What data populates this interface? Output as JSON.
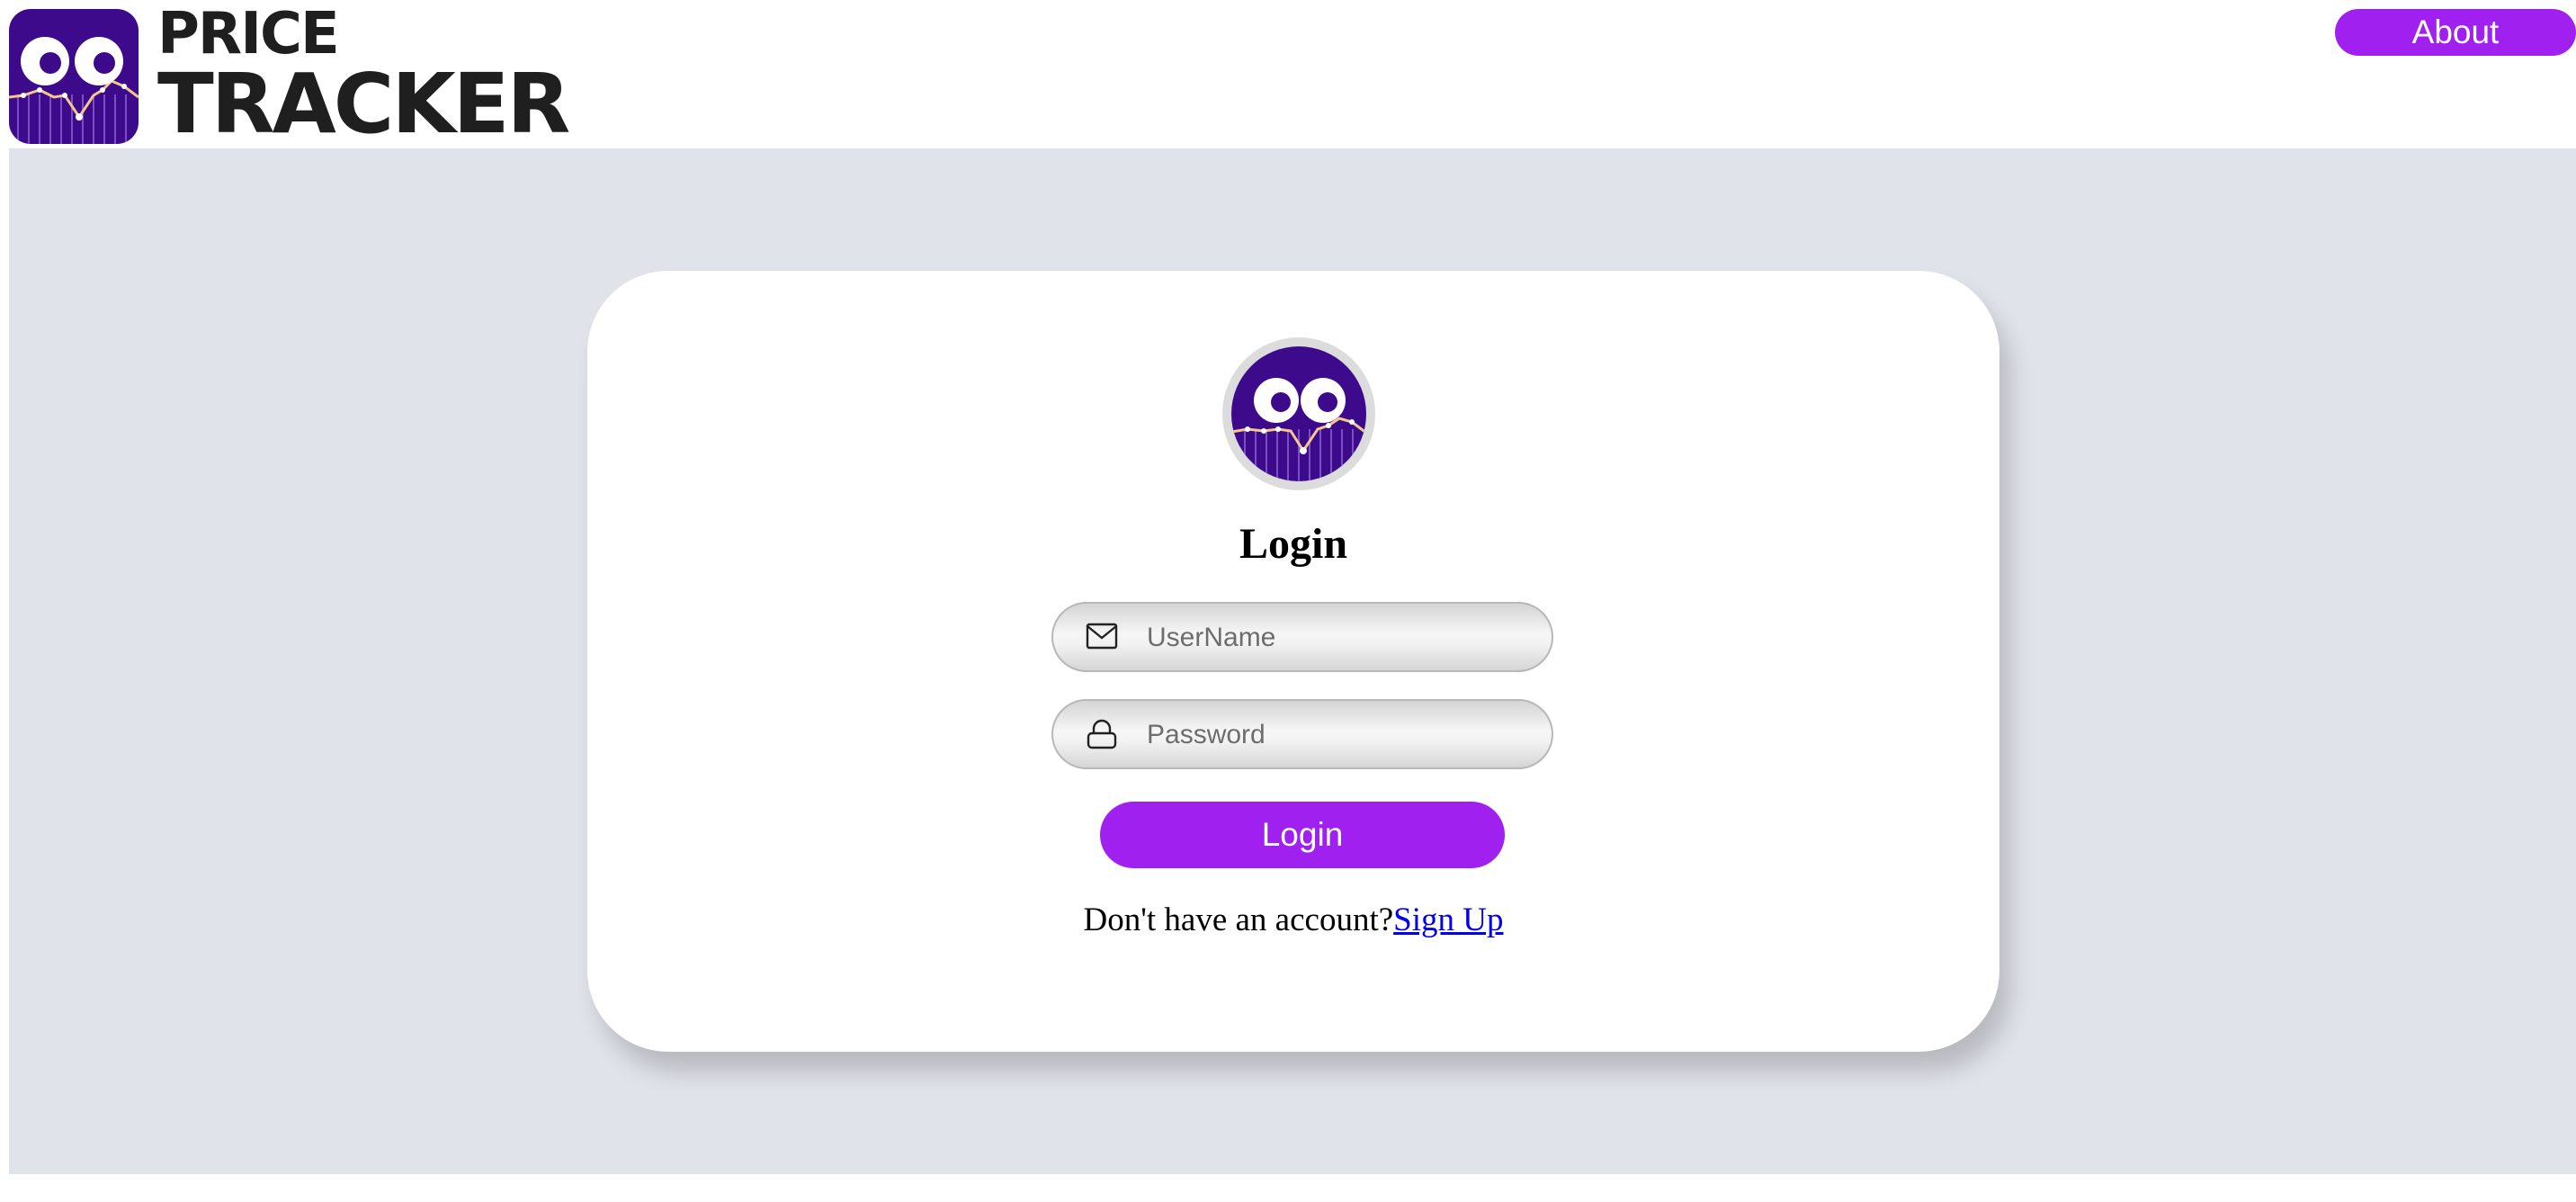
{
  "header": {
    "logo_line1": "PRICE",
    "logo_line2": "TRACKER",
    "about_label": "About"
  },
  "login": {
    "title": "Login",
    "username_placeholder": "UserName",
    "password_placeholder": "Password",
    "submit_label": "Login",
    "signup_prompt": "Don't have an account?",
    "signup_link": "Sign Up"
  },
  "icons": {
    "username_icon": "mail-icon",
    "password_icon": "lock-icon",
    "logo": "owl-chart-logo"
  },
  "colors": {
    "accent": "#a020f0",
    "logo_purple": "#3d0a8c",
    "background": "#e0e3ea",
    "link": "#0000ee"
  }
}
